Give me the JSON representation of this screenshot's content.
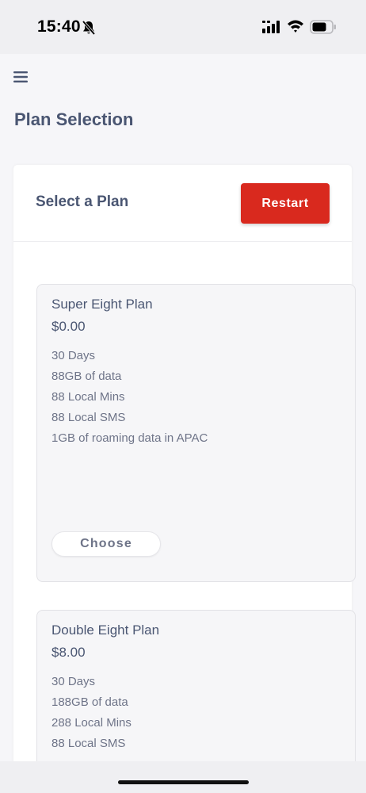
{
  "status_bar": {
    "time": "15:40",
    "icons": [
      "bell-muted-icon",
      "signal-icon",
      "wifi-icon",
      "battery-icon"
    ]
  },
  "header": {
    "menu_icon": "hamburger-menu-icon",
    "title": "Plan Selection"
  },
  "card": {
    "title": "Select a Plan",
    "restart_label": "Restart"
  },
  "plans": [
    {
      "name": "Super Eight Plan",
      "price": "$0.00",
      "features": [
        "30 Days",
        "88GB of data",
        "88 Local Mins",
        "88 Local SMS",
        "1GB of roaming data in APAC"
      ],
      "choose_label": "Choose"
    },
    {
      "name": "Double Eight Plan",
      "price": "$8.00",
      "features": [
        "30 Days",
        "188GB of data",
        "288 Local Mins",
        "88 Local SMS"
      ]
    }
  ],
  "colors": {
    "accent": "#d9291e",
    "heading": "#4a5672",
    "body_text": "#6e7488"
  }
}
